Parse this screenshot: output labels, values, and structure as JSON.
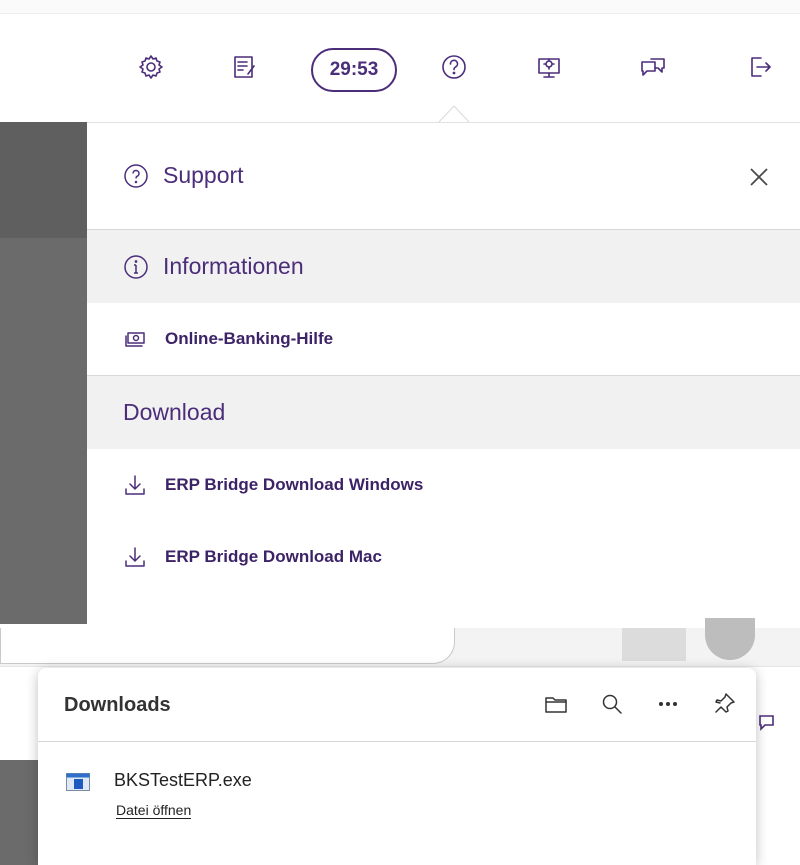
{
  "toolbar": {
    "timer": "29:53",
    "icons": [
      "gear-icon",
      "document-edit-icon",
      "help-circle-icon",
      "monitor-settings-icon",
      "chat-bubbles-icon",
      "logout-icon"
    ]
  },
  "support_panel": {
    "title": "Support",
    "sections": [
      {
        "heading": "Informationen",
        "items": [
          {
            "label": "Online-Banking-Hilfe",
            "icon": "money-icon"
          }
        ]
      },
      {
        "heading": "Download",
        "items": [
          {
            "label": "ERP Bridge Download Windows",
            "icon": "download-icon"
          },
          {
            "label": "ERP Bridge Download Mac",
            "icon": "download-icon"
          }
        ]
      }
    ]
  },
  "downloads": {
    "title": "Downloads",
    "file": {
      "name": "BKSTestERP.exe",
      "action": "Datei öffnen"
    }
  },
  "colors": {
    "accent": "#4b2d7a",
    "section_bg": "#f1f1f1",
    "sidebar_grey": "#6b6b6b"
  }
}
